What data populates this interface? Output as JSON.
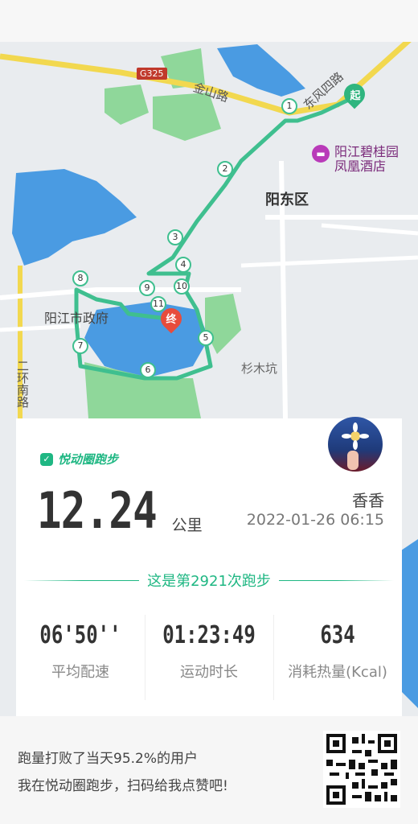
{
  "map": {
    "road_g325": "G325",
    "road_jinshan": "金山路",
    "road_dongfeng": "东风四路",
    "district": "阳东区",
    "hotel_line1": "阳江碧桂园",
    "hotel_line2": "凤凰酒店",
    "city_gov": "阳江市政府",
    "shanmukeng": "杉木坑",
    "ring_road": "二环南路",
    "start_marker": "起",
    "end_marker": "终",
    "waypoints": [
      "1",
      "2",
      "3",
      "4",
      "5",
      "6",
      "7",
      "8",
      "9",
      "10",
      "11"
    ]
  },
  "card": {
    "brand": "悦动圈跑步",
    "distance": "12.24",
    "distance_unit": "公里",
    "username": "香香",
    "datetime": "2022-01-26 06:15",
    "run_count_text": "这是第2921次跑步",
    "stats": [
      {
        "value": "06'50''",
        "label": "平均配速"
      },
      {
        "value": "01:23:49",
        "label": "运动时长"
      },
      {
        "value": "634",
        "label": "消耗热量(Kcal)"
      }
    ]
  },
  "footer": {
    "line1": "跑量打败了当天95.2%的用户",
    "line2": "我在悦动圈跑步，扫码给我点赞吧!"
  }
}
